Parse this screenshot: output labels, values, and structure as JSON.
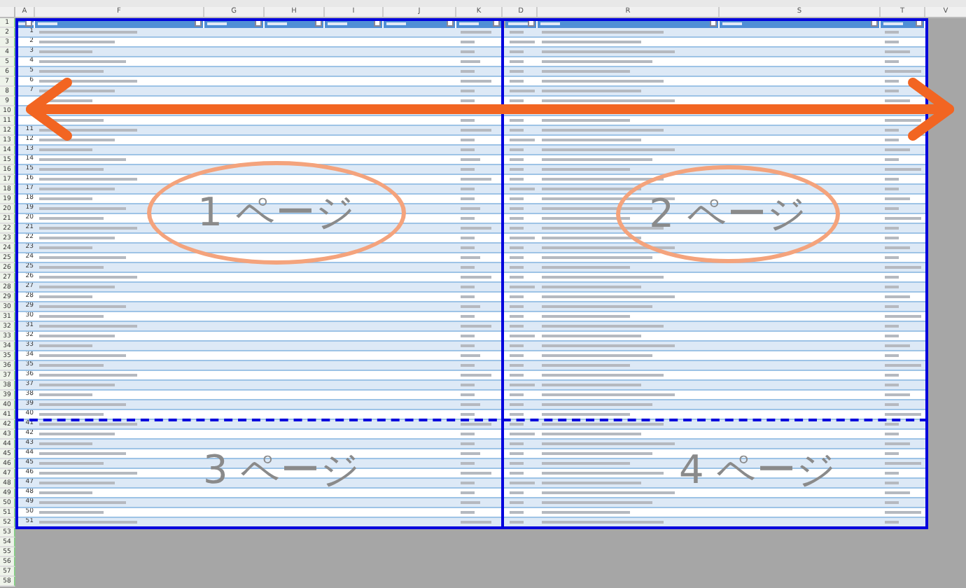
{
  "columns": [
    {
      "letter": "A"
    },
    {
      "letter": "F"
    },
    {
      "letter": "G"
    },
    {
      "letter": "H"
    },
    {
      "letter": "I"
    },
    {
      "letter": "J"
    },
    {
      "letter": "K"
    },
    {
      "letter": "D"
    },
    {
      "letter": "R"
    },
    {
      "letter": "S"
    },
    {
      "letter": "T"
    },
    {
      "letter": "V"
    }
  ],
  "rows": [
    {
      "number": "1",
      "kind": "header"
    },
    {
      "number": "2",
      "kind": "data",
      "no": "1"
    },
    {
      "number": "3",
      "kind": "data",
      "no": "2"
    },
    {
      "number": "4",
      "kind": "data",
      "no": "3"
    },
    {
      "number": "5",
      "kind": "data",
      "no": "4"
    },
    {
      "number": "6",
      "kind": "data",
      "no": "5"
    },
    {
      "number": "7",
      "kind": "data",
      "no": "6"
    },
    {
      "number": "8",
      "kind": "data",
      "no": "7"
    },
    {
      "number": "9",
      "kind": "data"
    },
    {
      "number": "10",
      "kind": "data"
    },
    {
      "number": "11",
      "kind": "data"
    },
    {
      "number": "12",
      "kind": "data",
      "no": "11"
    },
    {
      "number": "13",
      "kind": "data",
      "no": "12"
    },
    {
      "number": "14",
      "kind": "data",
      "no": "13"
    },
    {
      "number": "15",
      "kind": "data",
      "no": "14"
    },
    {
      "number": "16",
      "kind": "data",
      "no": "15"
    },
    {
      "number": "17",
      "kind": "data",
      "no": "16"
    },
    {
      "number": "18",
      "kind": "data",
      "no": "17"
    },
    {
      "number": "19",
      "kind": "data",
      "no": "18"
    },
    {
      "number": "20",
      "kind": "data",
      "no": "19"
    },
    {
      "number": "21",
      "kind": "data",
      "no": "20"
    },
    {
      "number": "22",
      "kind": "data",
      "no": "21"
    },
    {
      "number": "23",
      "kind": "data",
      "no": "22"
    },
    {
      "number": "24",
      "kind": "data",
      "no": "23"
    },
    {
      "number": "25",
      "kind": "data",
      "no": "24"
    },
    {
      "number": "26",
      "kind": "data",
      "no": "25"
    },
    {
      "number": "27",
      "kind": "data",
      "no": "26"
    },
    {
      "number": "28",
      "kind": "data",
      "no": "27"
    },
    {
      "number": "29",
      "kind": "data",
      "no": "28"
    },
    {
      "number": "30",
      "kind": "data",
      "no": "29"
    },
    {
      "number": "31",
      "kind": "data",
      "no": "30"
    },
    {
      "number": "32",
      "kind": "data",
      "no": "31"
    },
    {
      "number": "33",
      "kind": "data",
      "no": "32"
    },
    {
      "number": "34",
      "kind": "data",
      "no": "33"
    },
    {
      "number": "35",
      "kind": "data",
      "no": "34"
    },
    {
      "number": "36",
      "kind": "data",
      "no": "35"
    },
    {
      "number": "37",
      "kind": "data",
      "no": "36"
    },
    {
      "number": "38",
      "kind": "data",
      "no": "37"
    },
    {
      "number": "39",
      "kind": "data",
      "no": "38"
    },
    {
      "number": "40",
      "kind": "data",
      "no": "39"
    },
    {
      "number": "41",
      "kind": "data",
      "no": "40"
    },
    {
      "number": "42",
      "kind": "data",
      "no": "41"
    },
    {
      "number": "43",
      "kind": "data",
      "no": "42"
    },
    {
      "number": "44",
      "kind": "data",
      "no": "43"
    },
    {
      "number": "45",
      "kind": "data",
      "no": "44"
    },
    {
      "number": "46",
      "kind": "data",
      "no": "45"
    },
    {
      "number": "47",
      "kind": "data",
      "no": "46"
    },
    {
      "number": "48",
      "kind": "data",
      "no": "47"
    },
    {
      "number": "49",
      "kind": "data",
      "no": "48"
    },
    {
      "number": "50",
      "kind": "data",
      "no": "49"
    },
    {
      "number": "51",
      "kind": "data",
      "no": "50"
    },
    {
      "number": "52",
      "kind": "data",
      "no": "51"
    },
    {
      "number": "53",
      "kind": "empty"
    },
    {
      "number": "54",
      "kind": "empty"
    },
    {
      "number": "55",
      "kind": "empty"
    },
    {
      "number": "56",
      "kind": "empty"
    },
    {
      "number": "57",
      "kind": "empty"
    },
    {
      "number": "58",
      "kind": "empty"
    }
  ],
  "page_labels": [
    {
      "text": "1 ページ",
      "circled": true
    },
    {
      "text": "2 ページ",
      "circled": true
    },
    {
      "text": "3 ページ",
      "circled": false
    },
    {
      "text": "4 ページ",
      "circled": false
    }
  ]
}
